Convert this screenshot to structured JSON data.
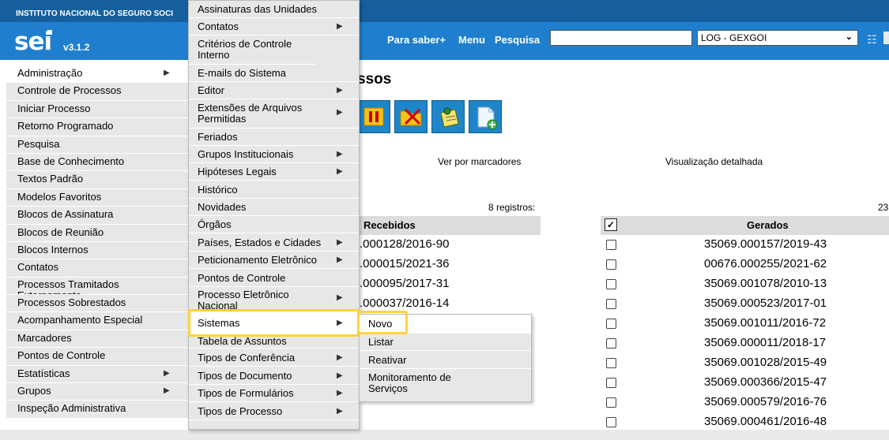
{
  "header": {
    "institution": "INSTITUTO NACIONAL DO SEGURO SOCI",
    "logo": "sei",
    "version": "v3.1.2",
    "links": [
      "Para saber+",
      "Menu",
      "Pesquisa"
    ],
    "search_value": "",
    "unit_selected": "LOG - GEXGOI"
  },
  "left_menu": [
    {
      "label": "Administração",
      "arrow": "▶"
    },
    {
      "label": "Controle de Processos"
    },
    {
      "label": "Iniciar Processo"
    },
    {
      "label": "Retorno Programado"
    },
    {
      "label": "Pesquisa"
    },
    {
      "label": "Base de Conhecimento"
    },
    {
      "label": "Textos Padrão"
    },
    {
      "label": "Modelos Favoritos"
    },
    {
      "label": "Blocos de Assinatura"
    },
    {
      "label": "Blocos de Reunião"
    },
    {
      "label": "Blocos Internos"
    },
    {
      "label": "Contatos"
    },
    {
      "label": "Processos Tramitados Externamente"
    },
    {
      "label": "Processos Sobrestados"
    },
    {
      "label": "Acompanhamento Especial"
    },
    {
      "label": "Marcadores"
    },
    {
      "label": "Pontos de Controle"
    },
    {
      "label": "Estatísticas",
      "arrow": "▶"
    },
    {
      "label": "Grupos",
      "arrow": "▶"
    },
    {
      "label": "Inspeção Administrativa"
    }
  ],
  "admin_submenu": [
    {
      "label": "Assinaturas das Unidades"
    },
    {
      "label": "Contatos",
      "arrow": "▶"
    },
    {
      "label": "Critérios de Controle Interno"
    },
    {
      "label": "E-mails do Sistema"
    },
    {
      "label": "Editor",
      "arrow": "▶"
    },
    {
      "label": "Extensões de Arquivos Permitidas",
      "arrow": "▶"
    },
    {
      "label": "Feriados"
    },
    {
      "label": "Grupos Institucionais",
      "arrow": "▶"
    },
    {
      "label": "Hipóteses Legais",
      "arrow": "▶"
    },
    {
      "label": "Histórico"
    },
    {
      "label": "Novidades"
    },
    {
      "label": "Órgãos"
    },
    {
      "label": "Países, Estados e Cidades",
      "arrow": "▶"
    },
    {
      "label": "Peticionamento Eletrônico",
      "arrow": "▶"
    },
    {
      "label": "Pontos de Controle"
    },
    {
      "label": "Processo Eletrônico Nacional",
      "arrow": "▶"
    },
    {
      "label": "Sistemas",
      "arrow": "▶"
    },
    {
      "label": "Tabela de Assuntos"
    },
    {
      "label": "Tipos de Conferência",
      "arrow": "▶"
    },
    {
      "label": "Tipos de Documento",
      "arrow": "▶"
    },
    {
      "label": "Tipos de Formulários",
      "arrow": "▶"
    },
    {
      "label": "Tipos de Processo",
      "arrow": "▶"
    }
  ],
  "sistemas_submenu": [
    {
      "label": "Novo"
    },
    {
      "label": "Listar"
    },
    {
      "label": "Reativar"
    },
    {
      "label": "Monitoramento de Serviços"
    }
  ],
  "main": {
    "title": "ssos",
    "toolbar_icons": [
      "pause-icon",
      "remove-marker-icon",
      "annotation-icon",
      "new-document-icon"
    ],
    "view_markers": "Ver por marcadores",
    "view_detailed": "Visualização detalhada",
    "received_count": "8 registros:",
    "generated_count": "23",
    "received_header": "Recebidos",
    "generated_header": "Gerados",
    "received_rows": [
      ".000128/2016-90",
      ".000015/2021-36",
      ".000095/2017-31",
      ".000037/2016-14"
    ],
    "generated_rows": [
      "35069.000157/2019-43",
      "00676.000255/2021-62",
      "35069.001078/2010-13",
      "35069.000523/2017-01",
      "35069.001011/2016-72",
      "35069.000011/2018-17",
      "35069.001028/2015-49",
      "35069.000366/2015-47",
      "35069.000579/2016-76",
      "35069.000461/2016-48"
    ]
  },
  "colors": {
    "header_dark": "#155f9c",
    "header": "#1f7fce",
    "menu_bg": "#e7e7e7",
    "highlight": "#ffd23f"
  }
}
